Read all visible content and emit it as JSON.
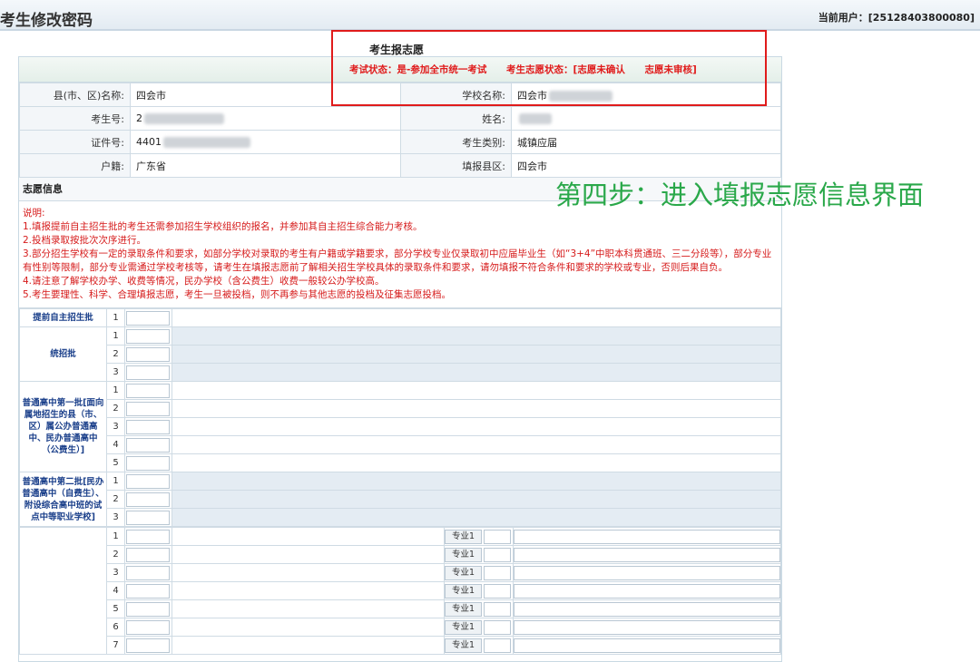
{
  "header": {
    "title": "考生修改密码",
    "current_user": "当前用户：[25128403800080]"
  },
  "status_box": {
    "title": "考生报志愿",
    "exam_status": "考试状态：是-参加全市统一考试",
    "volunteer_status": "考生志愿状态：[志愿未确认",
    "review_status": "志愿未审核]"
  },
  "info": {
    "county_label": "县(市、区)名称:",
    "county_value": "四会市",
    "school_label": "学校名称:",
    "school_value": "四会市",
    "exam_no_label": "考生号:",
    "exam_no_value": "2",
    "name_label": "姓名:",
    "id_label": "证件号:",
    "id_value": "4401",
    "type_label": "考生类别:",
    "type_value": "城镇应届",
    "hukou_label": "户籍:",
    "hukou_value": "广东省",
    "fill_county_label": "填报县区:",
    "fill_county_value": "四会市"
  },
  "volunteer": {
    "section_title": "志愿信息",
    "notes": [
      "说明:",
      "1.填报提前自主招生批的考生还需参加招生学校组织的报名，并参加其自主招生综合能力考核。",
      "2.投档录取按批次次序进行。",
      "3.部分招生学校有一定的录取条件和要求，如部分学校对录取的考生有户籍或学籍要求，部分学校专业仅录取初中应届毕业生（如“3+4”中职本科贯通班、三二分段等），部分专业有性别等限制，部分专业需通过学校考核等，请考生在填报志愿前了解相关招生学校具体的录取条件和要求，请勿填报不符合条件和要求的学校或专业，否则后果自负。",
      "4.请注意了解学校办学、收费等情况，民办学校（含公费生）收费一般较公办学校高。",
      "5.考生要理性、科学、合理填报志愿，考生一旦被投档，则不再参与其他志愿的投档及征集志愿投档。"
    ],
    "batches": [
      {
        "name": "提前自主招生批",
        "rows": [
          "1"
        ]
      },
      {
        "name": "统招批",
        "rows": [
          "1",
          "2",
          "3"
        ]
      },
      {
        "name": "普通高中第一批[面向属地招生的县（市、区）属公办普通高中、民办普通高中（公费生）]",
        "rows": [
          "1",
          "2",
          "3",
          "4",
          "5"
        ]
      },
      {
        "name": "普通高中第二批[民办普通高中（自费生）、附设综合高中班的试点中等职业学校]",
        "rows": [
          "1",
          "2",
          "3"
        ]
      }
    ],
    "major_rows": [
      "1",
      "2",
      "3",
      "4",
      "5",
      "6",
      "7"
    ],
    "major_label": "专业1"
  },
  "annotation": "第四步：进入填报志愿信息界面",
  "colors": {
    "frame_red": "#e01b1b",
    "annotation_green": "#2aa84a",
    "category_blue": "#1a3f8a",
    "note_red": "#d61b1b"
  }
}
